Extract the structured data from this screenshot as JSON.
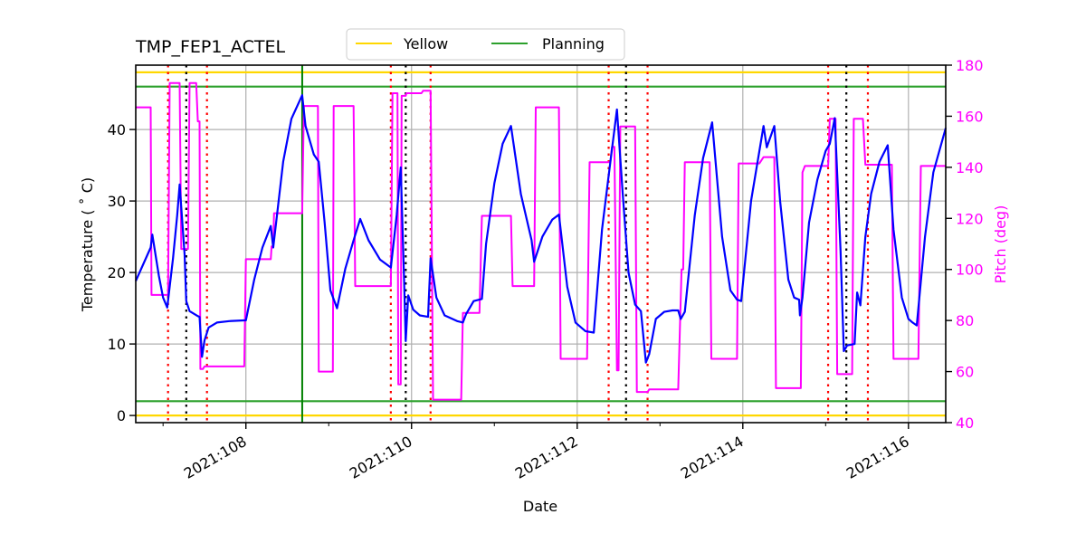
{
  "chart_data": {
    "type": "line",
    "title": "TMP_FEP1_ACTEL",
    "xlabel": "Date",
    "ylabel": "Temperature ($^\\circ$C)",
    "ylabel_display": "Temperature ( ˚ C)",
    "y2label": "Pitch (deg)",
    "xlim": [
      106.67,
      116.45
    ],
    "ylim": [
      -1,
      49
    ],
    "y2lim": [
      40,
      180
    ],
    "grid": true,
    "legend_position": "top-center",
    "x_ticks": [
      {
        "value": 108,
        "label": "2021:108"
      },
      {
        "value": 110,
        "label": "2021:110"
      },
      {
        "value": 112,
        "label": "2021:112"
      },
      {
        "value": 114,
        "label": "2021:114"
      },
      {
        "value": 116,
        "label": "2021:116"
      }
    ],
    "x_minor_ticks": [
      107,
      109,
      111,
      113,
      115
    ],
    "y_ticks": [
      0,
      10,
      20,
      30,
      40
    ],
    "y2_ticks": [
      40,
      60,
      80,
      100,
      120,
      140,
      160,
      180
    ],
    "legend": [
      {
        "name": "Yellow",
        "color": "#ffd700"
      },
      {
        "name": "Planning",
        "color": "#2ca02c"
      }
    ],
    "limit_lines": [
      {
        "name": "Yellow",
        "color": "#ffd700",
        "values": [
          48.0,
          0.0
        ]
      },
      {
        "name": "Planning",
        "color": "#2ca02c",
        "values": [
          46.0,
          2.0
        ]
      }
    ],
    "markers": {
      "red_dotted": [
        107.06,
        107.53,
        109.75,
        110.23,
        112.38,
        112.85,
        115.03,
        115.51
      ],
      "black_dotted": [
        107.28,
        109.93,
        112.59,
        115.25
      ],
      "green_solid": [
        108.68
      ]
    },
    "series": [
      {
        "name": "Temperature",
        "axis": "left",
        "color": "#0000ff",
        "points": [
          [
            106.67,
            18.8
          ],
          [
            106.85,
            23.5
          ],
          [
            106.87,
            25.3
          ],
          [
            106.95,
            19.5
          ],
          [
            107.0,
            16.5
          ],
          [
            107.05,
            15.1
          ],
          [
            107.12,
            22.0
          ],
          [
            107.17,
            28.0
          ],
          [
            107.2,
            32.3
          ],
          [
            107.26,
            22.5
          ],
          [
            107.28,
            16.0
          ],
          [
            107.32,
            14.6
          ],
          [
            107.42,
            13.9
          ],
          [
            107.44,
            13.8
          ],
          [
            107.47,
            8.2
          ],
          [
            107.5,
            10.5
          ],
          [
            107.55,
            12.3
          ],
          [
            107.65,
            13.0
          ],
          [
            107.8,
            13.2
          ],
          [
            107.98,
            13.3
          ],
          [
            108.0,
            13.3
          ],
          [
            108.1,
            19.0
          ],
          [
            108.2,
            23.5
          ],
          [
            108.3,
            26.5
          ],
          [
            108.33,
            23.5
          ],
          [
            108.38,
            28.5
          ],
          [
            108.45,
            35.5
          ],
          [
            108.55,
            41.5
          ],
          [
            108.68,
            44.8
          ],
          [
            108.72,
            40.5
          ],
          [
            108.82,
            36.5
          ],
          [
            108.88,
            35.5
          ],
          [
            108.95,
            27.0
          ],
          [
            109.02,
            17.5
          ],
          [
            109.1,
            15.0
          ],
          [
            109.2,
            20.5
          ],
          [
            109.3,
            24.5
          ],
          [
            109.38,
            27.5
          ],
          [
            109.48,
            24.5
          ],
          [
            109.62,
            21.8
          ],
          [
            109.75,
            20.7
          ],
          [
            109.82,
            28.0
          ],
          [
            109.87,
            34.7
          ],
          [
            109.91,
            19.0
          ],
          [
            109.93,
            10.4
          ],
          [
            109.96,
            16.8
          ],
          [
            110.02,
            14.8
          ],
          [
            110.1,
            14.0
          ],
          [
            110.2,
            13.8
          ],
          [
            110.23,
            22.0
          ],
          [
            110.3,
            16.5
          ],
          [
            110.4,
            14.0
          ],
          [
            110.55,
            13.2
          ],
          [
            110.62,
            13.0
          ],
          [
            110.66,
            14.2
          ],
          [
            110.75,
            16.0
          ],
          [
            110.85,
            16.3
          ],
          [
            110.9,
            24.0
          ],
          [
            111.0,
            32.5
          ],
          [
            111.1,
            38.0
          ],
          [
            111.2,
            40.5
          ],
          [
            111.32,
            31.0
          ],
          [
            111.45,
            24.5
          ],
          [
            111.48,
            21.5
          ],
          [
            111.58,
            25.0
          ],
          [
            111.7,
            27.4
          ],
          [
            111.78,
            28.1
          ],
          [
            111.88,
            18.0
          ],
          [
            111.98,
            13.0
          ],
          [
            112.1,
            11.8
          ],
          [
            112.2,
            11.6
          ],
          [
            112.3,
            26.0
          ],
          [
            112.38,
            33.5
          ],
          [
            112.48,
            42.8
          ],
          [
            112.55,
            31.0
          ],
          [
            112.62,
            20.0
          ],
          [
            112.7,
            15.5
          ],
          [
            112.77,
            14.6
          ],
          [
            112.83,
            7.4
          ],
          [
            112.87,
            8.6
          ],
          [
            112.95,
            13.5
          ],
          [
            113.05,
            14.5
          ],
          [
            113.15,
            14.7
          ],
          [
            113.22,
            14.7
          ],
          [
            113.25,
            13.5
          ],
          [
            113.3,
            14.5
          ],
          [
            113.42,
            28.0
          ],
          [
            113.52,
            36.0
          ],
          [
            113.63,
            41.0
          ],
          [
            113.75,
            25.0
          ],
          [
            113.85,
            17.5
          ],
          [
            113.93,
            16.2
          ],
          [
            113.98,
            16.0
          ],
          [
            114.1,
            30.0
          ],
          [
            114.2,
            37.0
          ],
          [
            114.25,
            40.5
          ],
          [
            114.29,
            37.5
          ],
          [
            114.38,
            40.5
          ],
          [
            114.45,
            30.0
          ],
          [
            114.55,
            19.0
          ],
          [
            114.62,
            16.5
          ],
          [
            114.68,
            16.2
          ],
          [
            114.69,
            14.0
          ],
          [
            114.72,
            16.5
          ],
          [
            114.8,
            27.0
          ],
          [
            114.9,
            33.0
          ],
          [
            115.0,
            37.0
          ],
          [
            115.05,
            38.0
          ],
          [
            115.11,
            41.6
          ],
          [
            115.18,
            23.0
          ],
          [
            115.22,
            9.0
          ],
          [
            115.26,
            9.8
          ],
          [
            115.35,
            10.0
          ],
          [
            115.38,
            17.2
          ],
          [
            115.42,
            15.4
          ],
          [
            115.48,
            25.0
          ],
          [
            115.55,
            31.0
          ],
          [
            115.65,
            35.5
          ],
          [
            115.75,
            37.8
          ],
          [
            115.82,
            26.0
          ],
          [
            115.92,
            16.5
          ],
          [
            116.0,
            13.5
          ],
          [
            116.05,
            13.0
          ],
          [
            116.1,
            12.6
          ],
          [
            116.2,
            25.0
          ],
          [
            116.3,
            34.0
          ],
          [
            116.45,
            40.2
          ]
        ]
      },
      {
        "name": "Pitch",
        "axis": "right",
        "color": "#ff00ff",
        "points": [
          [
            106.67,
            163.5
          ],
          [
            106.85,
            163.5
          ],
          [
            106.86,
            90
          ],
          [
            107.03,
            90
          ],
          [
            107.06,
            90
          ],
          [
            107.08,
            173
          ],
          [
            107.2,
            173
          ],
          [
            107.22,
            108
          ],
          [
            107.3,
            108
          ],
          [
            107.32,
            173
          ],
          [
            107.4,
            173
          ],
          [
            107.42,
            158
          ],
          [
            107.44,
            158
          ],
          [
            107.45,
            61
          ],
          [
            107.48,
            61
          ],
          [
            107.5,
            62
          ],
          [
            107.98,
            62
          ],
          [
            108.0,
            104
          ],
          [
            108.3,
            104
          ],
          [
            108.31,
            109
          ],
          [
            108.33,
            109
          ],
          [
            108.34,
            122
          ],
          [
            108.68,
            122
          ],
          [
            108.7,
            164
          ],
          [
            108.87,
            164
          ],
          [
            108.88,
            60
          ],
          [
            109.05,
            60
          ],
          [
            109.06,
            164
          ],
          [
            109.3,
            164
          ],
          [
            109.32,
            93.5
          ],
          [
            109.75,
            93.5
          ],
          [
            109.77,
            169
          ],
          [
            109.83,
            169
          ],
          [
            109.84,
            55
          ],
          [
            109.87,
            55
          ],
          [
            109.88,
            168
          ],
          [
            109.93,
            168
          ],
          [
            109.94,
            169
          ],
          [
            110.12,
            169
          ],
          [
            110.14,
            170
          ],
          [
            110.16,
            170
          ],
          [
            110.23,
            170
          ],
          [
            110.26,
            49
          ],
          [
            110.6,
            49
          ],
          [
            110.62,
            83
          ],
          [
            110.82,
            83
          ],
          [
            110.85,
            121
          ],
          [
            111.2,
            121
          ],
          [
            111.22,
            93.5
          ],
          [
            111.48,
            93.5
          ],
          [
            111.5,
            163.5
          ],
          [
            111.78,
            163.5
          ],
          [
            111.8,
            65
          ],
          [
            112.12,
            65
          ],
          [
            112.15,
            142
          ],
          [
            112.4,
            142
          ],
          [
            112.42,
            148
          ],
          [
            112.45,
            148
          ],
          [
            112.48,
            60.5
          ],
          [
            112.5,
            60.5
          ],
          [
            112.52,
            156
          ],
          [
            112.7,
            156
          ],
          [
            112.72,
            52
          ],
          [
            112.85,
            52
          ],
          [
            112.87,
            53
          ],
          [
            113.22,
            53
          ],
          [
            113.26,
            100
          ],
          [
            113.28,
            100
          ],
          [
            113.3,
            142
          ],
          [
            113.6,
            142
          ],
          [
            113.62,
            65
          ],
          [
            113.93,
            65
          ],
          [
            113.95,
            141.5
          ],
          [
            114.2,
            141.5
          ],
          [
            114.25,
            144
          ],
          [
            114.38,
            144
          ],
          [
            114.4,
            53.5
          ],
          [
            114.7,
            53.5
          ],
          [
            114.72,
            138
          ],
          [
            114.75,
            140.5
          ],
          [
            115.03,
            140.5
          ],
          [
            115.05,
            159
          ],
          [
            115.12,
            159
          ],
          [
            115.14,
            59
          ],
          [
            115.32,
            59
          ],
          [
            115.34,
            159
          ],
          [
            115.45,
            159
          ],
          [
            115.48,
            141
          ],
          [
            115.8,
            141
          ],
          [
            115.82,
            65
          ],
          [
            116.12,
            65
          ],
          [
            116.15,
            140.5
          ],
          [
            116.45,
            140.5
          ]
        ]
      }
    ]
  }
}
